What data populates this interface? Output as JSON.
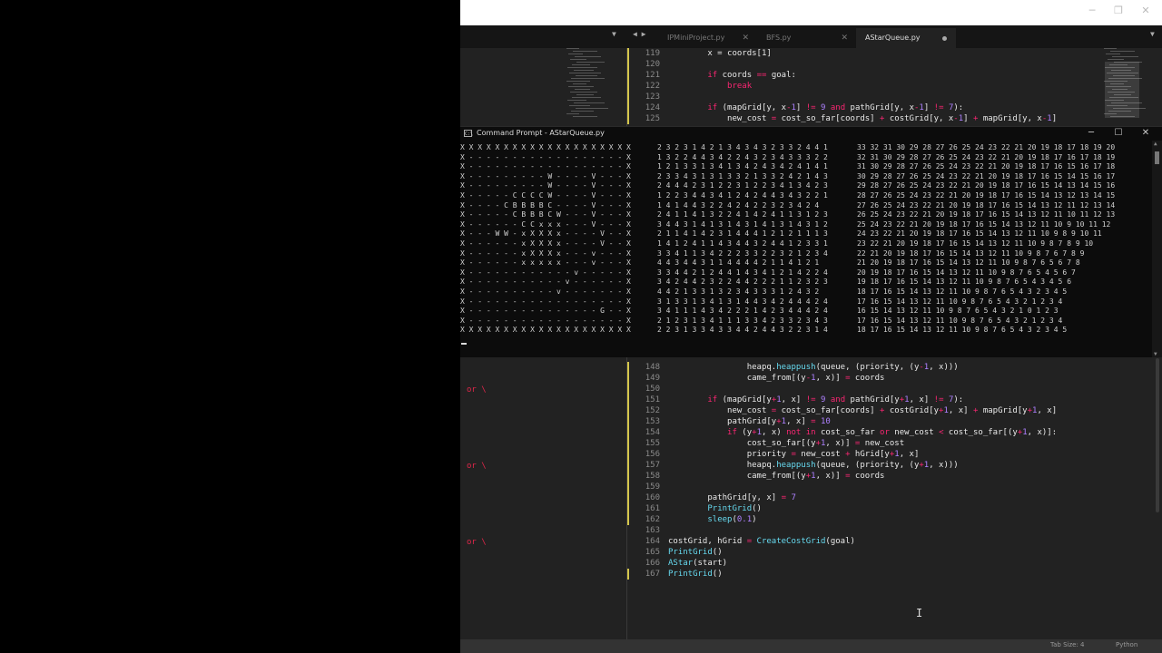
{
  "editor": {
    "tabs": [
      {
        "label": "IPMiniProject.py",
        "active": false
      },
      {
        "label": "BFS.py",
        "active": false
      },
      {
        "label": "AStarQueue.py",
        "active": true
      }
    ],
    "top_lines": [
      {
        "n": "119",
        "html": "        x = coords[1]"
      },
      {
        "n": "120",
        "html": ""
      },
      {
        "n": "121",
        "html": "        <span class=\"kw\">if</span> coords <span class=\"op\">==</span> goal:"
      },
      {
        "n": "122",
        "html": "            <span class=\"kw\">break</span>"
      },
      {
        "n": "123",
        "html": ""
      },
      {
        "n": "124",
        "html": "        <span class=\"kw\">if</span> (mapGrid[y, x<span class=\"op\">-</span><span class=\"num\">1</span>] <span class=\"op\">!=</span> <span class=\"num\">9</span> <span class=\"kw\">and</span> pathGrid[y, x<span class=\"op\">-</span><span class=\"num\">1</span>] <span class=\"op\">!=</span> <span class=\"num\">7</span>):"
      },
      {
        "n": "125",
        "html": "            new_cost <span class=\"op\">=</span> cost_so_far[coords] <span class=\"op\">+</span> costGrid[y, x<span class=\"op\">-</span><span class=\"num\">1</span>] <span class=\"op\">+</span> mapGrid[y, x<span class=\"op\">-</span><span class=\"num\">1</span>]"
      }
    ],
    "bottom_lines": [
      {
        "n": "148",
        "html": "                heapq.<span class=\"fn\">heappush</span>(queue, (priority, (y<span class=\"op\">-</span><span class=\"num\">1</span>, x)))"
      },
      {
        "n": "149",
        "html": "                came_from[(y<span class=\"op\">-</span><span class=\"num\">1</span>, x)] <span class=\"op\">=</span> coords"
      },
      {
        "n": "150",
        "html": ""
      },
      {
        "n": "151",
        "html": "        <span class=\"kw\">if</span> (mapGrid[y<span class=\"op\">+</span><span class=\"num\">1</span>, x] <span class=\"op\">!=</span> <span class=\"num\">9</span> <span class=\"kw\">and</span> pathGrid[y<span class=\"op\">+</span><span class=\"num\">1</span>, x] <span class=\"op\">!=</span> <span class=\"num\">7</span>):"
      },
      {
        "n": "152",
        "html": "            new_cost <span class=\"op\">=</span> cost_so_far[coords] <span class=\"op\">+</span> costGrid[y<span class=\"op\">+</span><span class=\"num\">1</span>, x] <span class=\"op\">+</span> mapGrid[y<span class=\"op\">+</span><span class=\"num\">1</span>, x]"
      },
      {
        "n": "153",
        "html": "            pathGrid[y<span class=\"op\">+</span><span class=\"num\">1</span>, x] <span class=\"op\">=</span> <span class=\"num\">10</span>"
      },
      {
        "n": "154",
        "html": "            <span class=\"kw\">if</span> (y<span class=\"op\">+</span><span class=\"num\">1</span>, x) <span class=\"kw\">not in</span> cost_so_far <span class=\"kw\">or</span> new_cost <span class=\"op\">&lt;</span> cost_so_far[(y<span class=\"op\">+</span><span class=\"num\">1</span>, x)]:"
      },
      {
        "n": "155",
        "html": "                cost_so_far[(y<span class=\"op\">+</span><span class=\"num\">1</span>, x)] <span class=\"op\">=</span> new_cost"
      },
      {
        "n": "156",
        "html": "                priority <span class=\"op\">=</span> new_cost <span class=\"op\">+</span> hGrid[y<span class=\"op\">+</span><span class=\"num\">1</span>, x]"
      },
      {
        "n": "157",
        "html": "                heapq.<span class=\"fn\">heappush</span>(queue, (priority, (y<span class=\"op\">+</span><span class=\"num\">1</span>, x)))"
      },
      {
        "n": "158",
        "html": "                came_from[(y<span class=\"op\">+</span><span class=\"num\">1</span>, x)] <span class=\"op\">=</span> coords"
      },
      {
        "n": "159",
        "html": ""
      },
      {
        "n": "160",
        "html": "        pathGrid[y, x] <span class=\"op\">=</span> <span class=\"num\">7</span>"
      },
      {
        "n": "161",
        "html": "        <span class=\"fn\">PrintGrid</span>()"
      },
      {
        "n": "162",
        "html": "        <span class=\"fn\">sleep</span>(<span class=\"num\">0.1</span>)"
      },
      {
        "n": "163",
        "html": ""
      },
      {
        "n": "164",
        "html": "costGrid, hGrid <span class=\"op\">=</span> <span class=\"fn\">CreateCostGrid</span>(goal)"
      },
      {
        "n": "165",
        "html": "<span class=\"fn\">PrintGrid</span>()"
      },
      {
        "n": "166",
        "html": "<span class=\"fn\">AStar</span>(start)"
      },
      {
        "n": "167",
        "html": "<span class=\"fn\">PrintGrid</span>()"
      }
    ],
    "side_or_text": "or \\",
    "status": {
      "tab_size": "Tab Size: 4",
      "syntax": "Python"
    }
  },
  "cmd": {
    "title": "Command Prompt - AStarQueue.py",
    "grid": [
      "X X X X X X X X X X X X X X X X X X X X",
      "X - - - - - - - - - - - - - - - - - - X",
      "X - - - - - - - - - - - - - - - - - - X",
      "X - - - - - - - - - W - - - - V - - - X",
      "X - - - - - - - - - W - - - - V - - - X",
      "X - - - - - C C C C W - - - - V - - - X",
      "X - - - - C B B B B C - - - - V - - - X",
      "X - - - - - C B B B C W - - - V - - - X",
      "X - - - - - - C C x x x - - - V - - - X",
      "X - - - W W - x X X X x - - - - V - - X",
      "X - - - - - - x X X X x - - - - V - - X",
      "X - - - - - - x X X X x - - - v - - - X",
      "X - - - - - - x x x x x - - - v - - - X",
      "X - - - - - - - - - - - - v - - - - - X",
      "X - - - - - - - - - - - v - - - - - - X",
      "X - - - - - - - - - - v - - - - - - - X",
      "X - - - - - - - - - - - - - - - - - - X",
      "X - - - - - - - - - - - - - - - G - - X",
      "X - - - - - - - - - - - - - - - - - - X",
      "X X X X X X X X X X X X X X X X X X X X"
    ],
    "costs": [
      "2 3 2 3 1 4 2 1 3 4 3 4 3 2 3 3 2 4 4 1",
      "1 3 2 2 4 4 3 4 2 2 4 3 2 3 4 3 3 3 2 2",
      "1 2 1 3 3 1 3 4 1 3 4 2 4 3 4 2 4 1 4 1",
      "2 3 3 4 3 1 3 1 3 3 2 1 3 3 2 4 2 1 4 3",
      "2 4 4 4 2 3 1 2 2 3 1 2 2 3 4 1 3 4 2 3",
      "1 2 2 3 4 4 3 4 1 2 4 2 4 4 3 4 3 2 2 1",
      "1 4 1 4 4 3 2 2 4 2 4 2 2 3 2 3 4 2 4",
      "2 4 1 1 4 1 3 2 2 4 1 4 2 4 1 1 3 1 2 3",
      "3 4 4 3 1 4 1 3 1 4 3 1 4 1 3 1 4 3 1 2",
      "2 1 1 4 1 4 2 3 1 4 4 4 1 2 1 2 1 1 1 3",
      "1 4 1 2 4 1 1 4 3 4 4 3 2 4 4 1 2 3 3 1",
      "3 3 4 1 1 3 4 2 2 2 3 3 2 2 3 2 1 2 3 4",
      "4 4 3 4 4 3 1 1 4 4 4 4 2 1 1 4 1 2 1",
      "3 3 4 4 2 1 2 4 4 1 4 3 4 1 2 1 4 2 2 4",
      "3 4 2 4 4 2 3 2 2 4 4 2 2 2 1 1 2 3 2 3",
      "4 4 2 1 3 3 1 3 2 3 4 3 3 3 1 2 4 3 2",
      "3 1 3 3 1 3 4 1 3 1 4 4 3 4 2 4 4 4 2 4",
      "3 4 1 1 1 4 3 4 2 2 2 1 4 2 3 4 4 4 2 4",
      "2 1 2 3 1 3 4 1 1 1 3 3 4 2 3 3 2 3 4 3",
      "2 2 3 1 3 3 4 3 3 4 4 2 4 4 3 2 2 3 1 4"
    ],
    "heuristics": [
      "33 32 31 30 29 28 27 26 25 24 23 22 21 20 19 18 17 18 19 20",
      "32 31 30 29 28 27 26 25 24 23 22 21 20 19 18 17 16 17 18 19",
      "31 30 29 28 27 26 25 24 23 22 21 20 19 18 17 16 15 16 17 18",
      "30 29 28 27 26 25 24 23 22 21 20 19 18 17 16 15 14 15 16 17",
      "29 28 27 26 25 24 23 22 21 20 19 18 17 16 15 14 13 14 15 16",
      "28 27 26 25 24 23 22 21 20 19 18 17 16 15 14 13 12 13 14 15",
      "27 26 25 24 23 22 21 20 19 18 17 16 15 14 13 12 11 12 13 14",
      "26 25 24 23 22 21 20 19 18 17 16 15 14 13 12 11 10 11 12 13",
      "25 24 23 22 21 20 19 18 17 16 15 14 13 12 11 10 9 10 11 12",
      "24 23 22 21 20 19 18 17 16 15 14 13 12 11 10 9 8 9 10 11",
      "23 22 21 20 19 18 17 16 15 14 13 12 11 10 9 8 7 8 9 10",
      "22 21 20 19 18 17 16 15 14 13 12 11 10 9 8 7 6 7 8 9",
      "21 20 19 18 17 16 15 14 13 12 11 10 9 8 7 6 5 6 7 8",
      "20 19 18 17 16 15 14 13 12 11 10 9 8 7 6 5 4 5 6 7",
      "19 18 17 16 15 14 13 12 11 10 9 8 7 6 5 4 3 4 5 6",
      "18 17 16 15 14 13 12 11 10 9 8 7 6 5 4 3 2 3 4 5",
      "17 16 15 14 13 12 11 10 9 8 7 6 5 4 3 2 1 2 3 4",
      "16 15 14 13 12 11 10 9 8 7 6 5 4 3 2 1 0 1 2 3",
      "17 16 15 14 13 12 11 10 9 8 7 6 5 4 3 2 1 2 3 4",
      "18 17 16 15 14 13 12 11 10 9 8 7 6 5 4 3 2 3 4 5"
    ]
  }
}
